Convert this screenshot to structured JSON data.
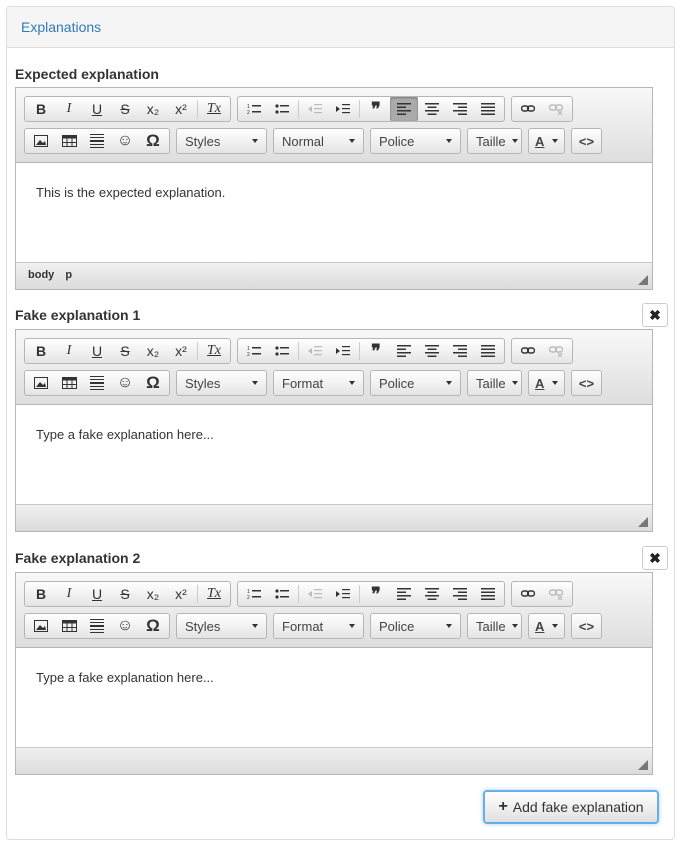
{
  "panel": {
    "title": "Explanations"
  },
  "toolbar": {
    "bold": "B",
    "italic": "I",
    "underline": "U",
    "strike": "S",
    "subscript": "x₂",
    "superscript": "x²",
    "clear_format": "Tx",
    "blockquote": "❞",
    "source": "<>",
    "symbol": "Ω",
    "text_color": "A"
  },
  "expected": {
    "label": "Expected explanation",
    "combos": [
      "Styles",
      "Normal",
      "Police",
      "Taille"
    ],
    "content": "This is the expected explanation.",
    "status": [
      "body",
      "p"
    ]
  },
  "fake1": {
    "label": "Fake explanation 1",
    "remove": "✖",
    "combos": [
      "Styles",
      "Format",
      "Police",
      "Taille"
    ],
    "content": "Type a fake explanation here..."
  },
  "fake2": {
    "label": "Fake explanation 2",
    "remove": "✖",
    "combos": [
      "Styles",
      "Format",
      "Police",
      "Taille"
    ],
    "content": "Type a fake explanation here..."
  },
  "add_button": {
    "icon": "+",
    "label": "Add fake explanation"
  }
}
